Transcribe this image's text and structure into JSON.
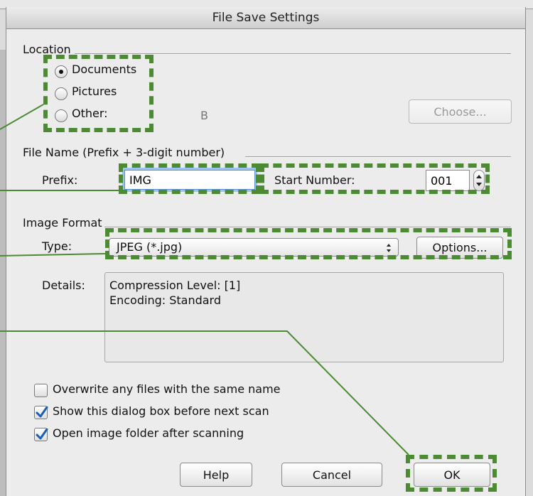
{
  "dialog": {
    "title": "File Save Settings"
  },
  "location": {
    "heading": "Location",
    "options": [
      {
        "label": "Documents",
        "selected": true
      },
      {
        "label": "Pictures",
        "selected": false
      },
      {
        "label": "Other:",
        "selected": false
      }
    ],
    "other_value": "B",
    "choose_button": "Choose..."
  },
  "file_name": {
    "heading": "File Name (Prefix + 3-digit number)",
    "prefix_label": "Prefix:",
    "prefix_value": "IMG",
    "start_number_label": "Start Number:",
    "start_number_value": "001"
  },
  "image_format": {
    "heading": "Image Format",
    "type_label": "Type:",
    "type_value": "JPEG (*.jpg)",
    "options_button": "Options...",
    "details_label": "Details:",
    "details_lines": [
      "Compression Level: [1]",
      "Encoding: Standard"
    ]
  },
  "checkboxes": [
    {
      "label": "Overwrite any files with the same name",
      "checked": false
    },
    {
      "label": "Show this dialog box before next scan",
      "checked": true
    },
    {
      "label": "Open image folder after scanning",
      "checked": true
    }
  ],
  "buttons": {
    "help": "Help",
    "cancel": "Cancel",
    "ok": "OK"
  },
  "colors": {
    "highlight": "#4d8a34",
    "focus_ring": "#9dc3ef",
    "checkmark": "#1a5fb4"
  },
  "icons": {
    "radio": "radio-button",
    "checkmark": "checkmark-icon",
    "select_arrows": "up-down-arrows-icon",
    "stepper": "stepper-arrows-icon"
  }
}
